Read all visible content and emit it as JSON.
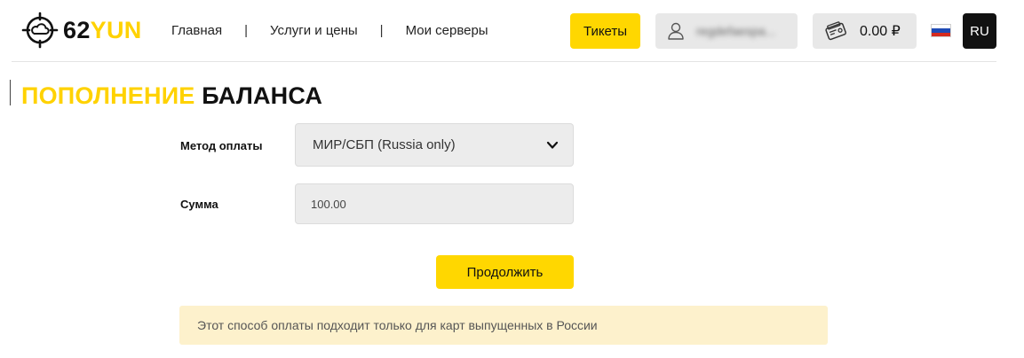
{
  "header": {
    "logo": {
      "number": "62",
      "suffix": "YUN",
      "icon": "cloud-globe-logo-icon"
    },
    "nav": [
      {
        "label": "Главная"
      },
      {
        "label": "Услуги и цены"
      },
      {
        "label": "Мои серверы"
      }
    ],
    "nav_separator": "|",
    "tickets_label": "Тикеты",
    "user": {
      "icon": "user-icon",
      "name": "regdefaespa..."
    },
    "wallet": {
      "icon": "wallet-icon",
      "balance": "0.00 ₽"
    },
    "flag": {
      "icon": "russia-flag-icon"
    },
    "lang_label": "RU"
  },
  "page": {
    "title_highlight": "ПОПОЛНЕНИЕ",
    "title_rest": "БАЛАНСА"
  },
  "form": {
    "method_label": "Метод оплаты",
    "method_value": "МИР/СБП (Russia only)",
    "amount_label": "Сумма",
    "amount_value": "100.00",
    "continue_label": "Продолжить",
    "notice": "Этот способ оплаты подходит только для карт выпущенных в России"
  },
  "colors": {
    "accent": "#ffd700",
    "notice_bg": "#fdf1cc",
    "field_bg": "#ececec",
    "dark": "#111111"
  }
}
